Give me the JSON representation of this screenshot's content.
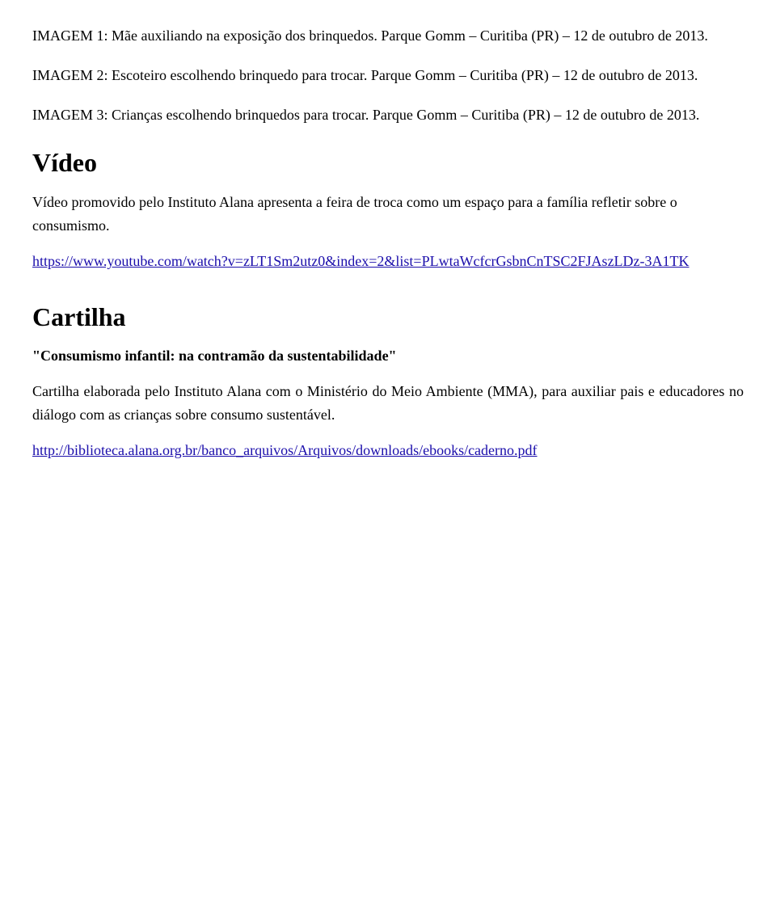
{
  "images": [
    {
      "label": "IMAGEM 1:",
      "description": "Mãe auxiliando na exposição dos brinquedos.",
      "location": "Parque Gomm – Curitiba (PR) – 12 de outubro de 2013."
    },
    {
      "label": "IMAGEM 2:",
      "description": "Escoteiro escolhendo brinquedo para trocar.",
      "location": "Parque Gomm – Curitiba (PR) – 12 de outubro de 2013."
    },
    {
      "label": "IMAGEM 3:",
      "description": "Crianças escolhendo brinquedos para trocar.",
      "location": "Parque Gomm – Curitiba (PR) – 12 de outubro de 2013."
    }
  ],
  "video_section": {
    "heading": "Vídeo",
    "description": "Vídeo promovido pelo Instituto Alana apresenta a feira de troca como um espaço para a família refletir sobre o consumismo.",
    "link_text": "https://www.youtube.com/watch?v=zLT1Sm2utz0&index=2&list=PLwtaWcfcrGsbnCnTSC2FJAszLDz-3A1TK",
    "link_url": "https://www.youtube.com/watch?v=zLT1Sm2utz0&index=2&list=PLwtaWcfcrGsbnCnTSC2FJAszLDz-3A1TK"
  },
  "cartilha_section": {
    "heading": "Cartilha",
    "quote": "\"Consumismo infantil: na contramão da sustentabilidade\"",
    "description": "Cartilha elaborada pelo Instituto Alana com o Ministério do Meio Ambiente (MMA), para auxiliar pais e educadores no diálogo com as crianças sobre consumo sustentável.",
    "link_text": "http://biblioteca.alana.org.br/banco_arquivos/Arquivos/downloads/ebooks/caderno.pdf",
    "link_url": "http://biblioteca.alana.org.br/banco_arquivos/Arquivos/downloads/ebooks/caderno.pdf"
  }
}
